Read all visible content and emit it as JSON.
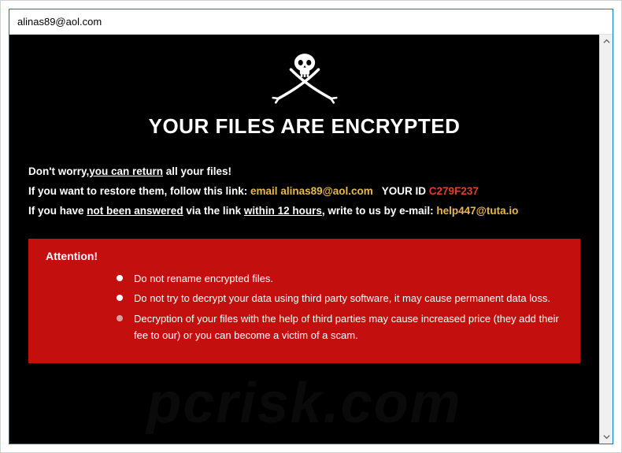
{
  "window": {
    "title": "alinas89@aol.com"
  },
  "main": {
    "heading": "YOUR FILES ARE ENCRYPTED",
    "line1_a": "Don't worry,",
    "line1_b": "you can return",
    "line1_c": " all your files!",
    "line2_a": "If you want to restore them, follow this link: ",
    "line2_email_label": "email ",
    "line2_email": "alinas89@aol.com",
    "line2_yourid_label": "   YOUR ID ",
    "line2_id": "C279F237",
    "line3_a": "If you have ",
    "line3_b": "not been answered",
    "line3_c": " via the link ",
    "line3_d": "within 12 hours",
    "line3_e": ", write to us by e-mail: ",
    "line3_email": "help447@tuta.io"
  },
  "attention": {
    "title": "Attention!",
    "items": [
      "Do not rename encrypted files.",
      "Do not try to decrypt your data using third party software, it may cause permanent data loss.",
      "Decryption of your files with the help of third parties may cause increased price (they add their fee to our) or you can become a victim of a scam."
    ]
  },
  "watermark": "pcrisk.com"
}
